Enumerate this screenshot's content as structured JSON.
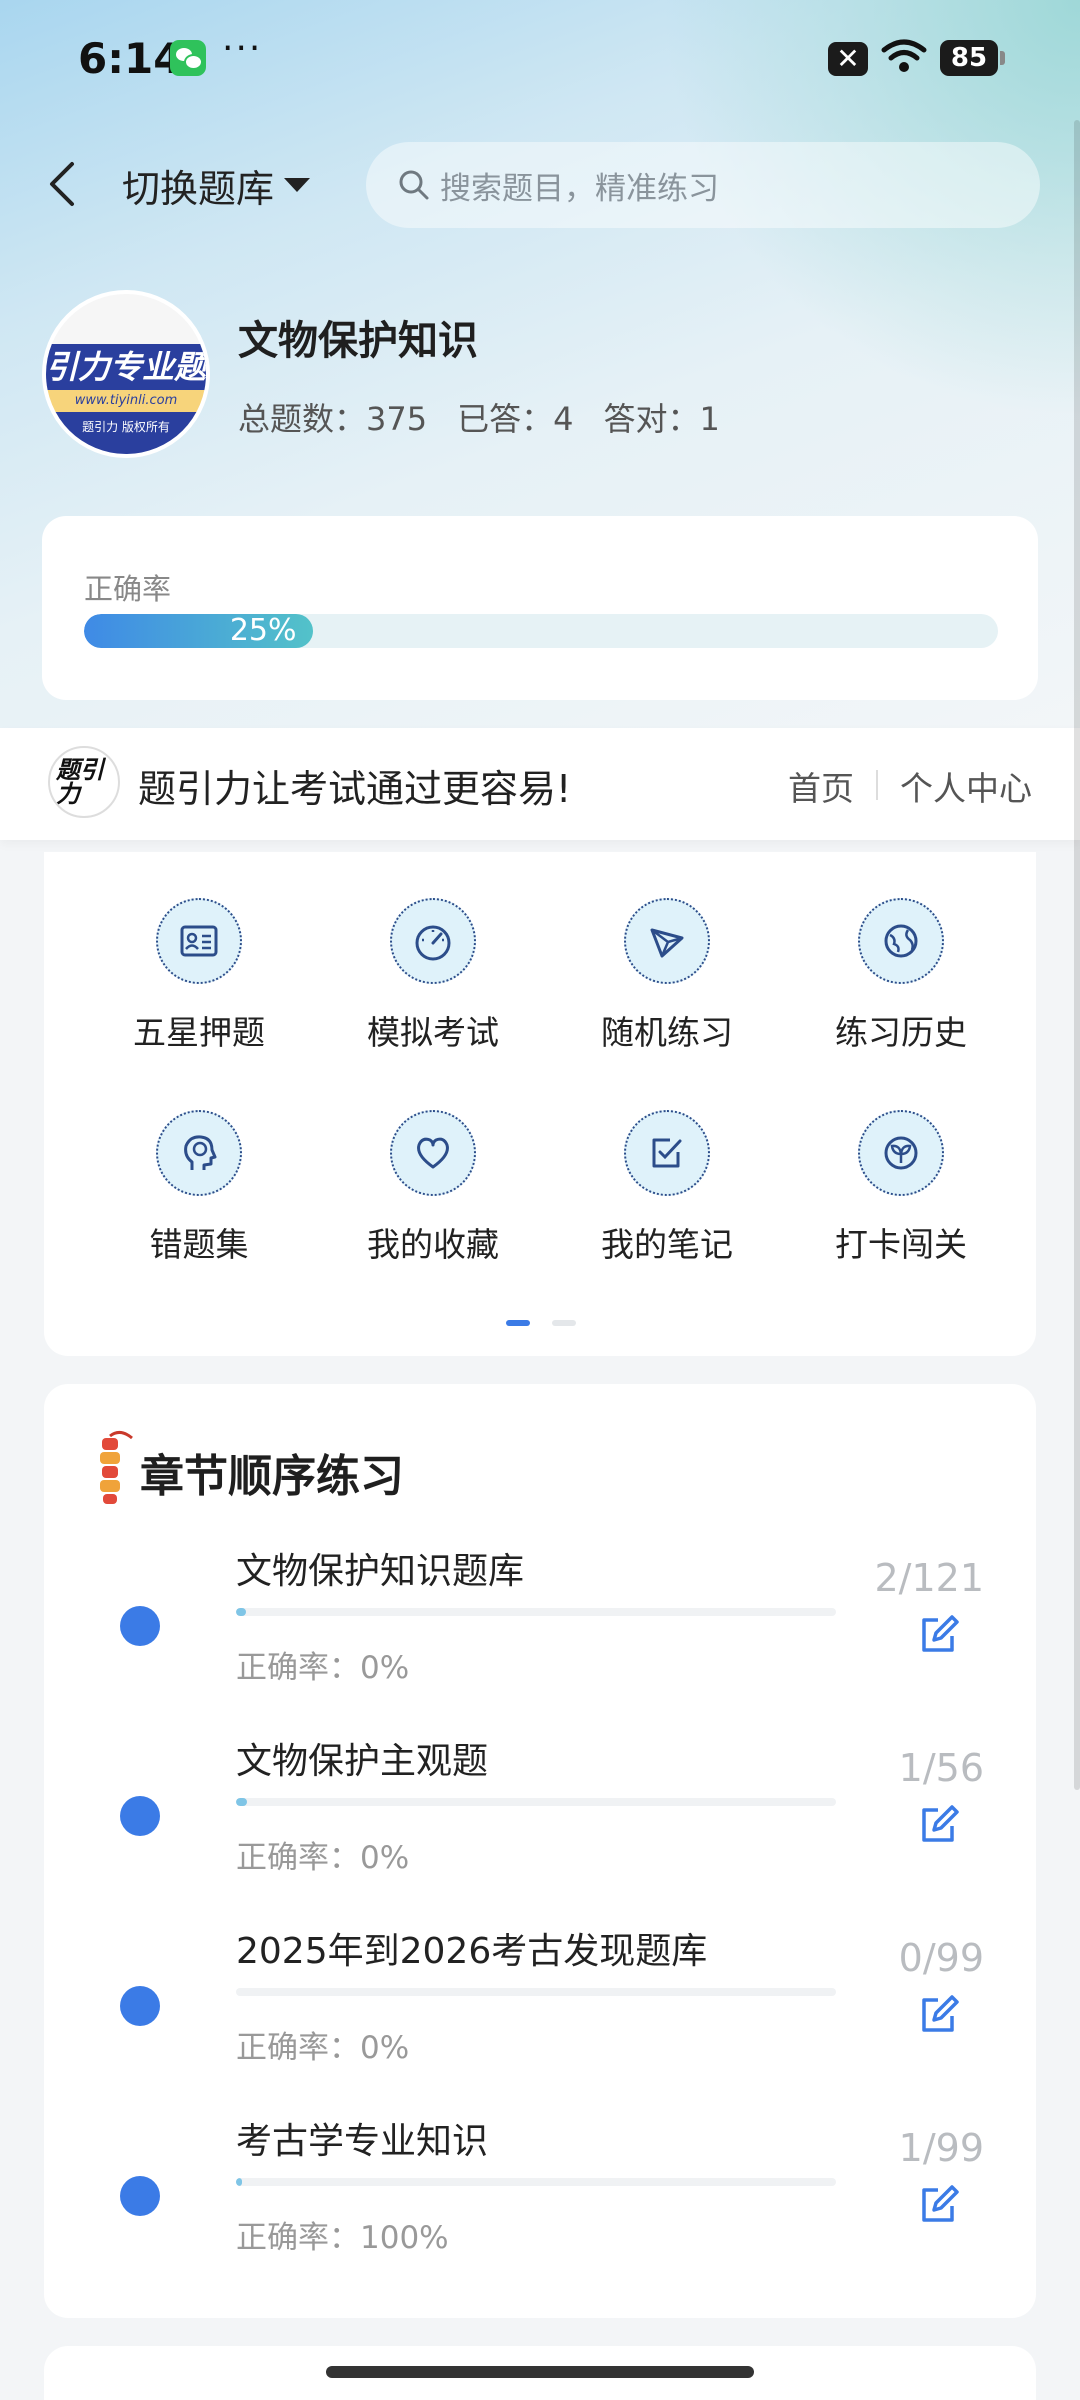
{
  "status_bar": {
    "time": "6:14",
    "dots": "···",
    "mute_glyph": "✕",
    "battery": "85"
  },
  "header": {
    "switch_label": "切换题库",
    "search_placeholder": "搜索题目，精准练习"
  },
  "bank": {
    "title": "文物保护知识",
    "total_label": "总题数：375",
    "answered_label": "已答：4",
    "correct_label": "答对：1",
    "logo_text": "引力专业题",
    "logo_url": "www.tiyinli.com",
    "logo_sub": "题引力 版权所有"
  },
  "accuracy": {
    "label": "正确率",
    "value_text": "25%",
    "value": 0.25
  },
  "slogan": {
    "logo_text": "题引力",
    "text": "题引力让考试通过更容易!",
    "nav_home": "首页",
    "nav_profile": "个人中心"
  },
  "grid": {
    "items": [
      {
        "label": "五星押题",
        "icon": "id-card-icon"
      },
      {
        "label": "模拟考试",
        "icon": "speedometer-icon"
      },
      {
        "label": "随机练习",
        "icon": "shuffle-icon"
      },
      {
        "label": "练习历史",
        "icon": "globe-history-icon"
      },
      {
        "label": "错题集",
        "icon": "brain-head-icon"
      },
      {
        "label": "我的收藏",
        "icon": "heart-icon"
      },
      {
        "label": "我的笔记",
        "icon": "note-check-icon"
      },
      {
        "label": "打卡闯关",
        "icon": "sprout-badge-icon"
      }
    ],
    "pager_active": 0
  },
  "chapters": {
    "title": "章节顺序练习",
    "items": [
      {
        "name": "文物保护知识题库",
        "accuracy": "正确率：0%",
        "count": "2/121",
        "progress": 0.0165
      },
      {
        "name": "文物保护主观题",
        "accuracy": "正确率：0%",
        "count": "1/56",
        "progress": 0.0179
      },
      {
        "name": "2025年到2026考古发现题库",
        "accuracy": "正确率：0%",
        "count": "0/99",
        "progress": 0
      },
      {
        "name": "考古学专业知识",
        "accuracy": "正确率：100%",
        "count": "1/99",
        "progress": 0.0101
      }
    ]
  },
  "colors": {
    "accent": "#3b7be6",
    "teal": "#53c2c9",
    "text": "#222222"
  }
}
